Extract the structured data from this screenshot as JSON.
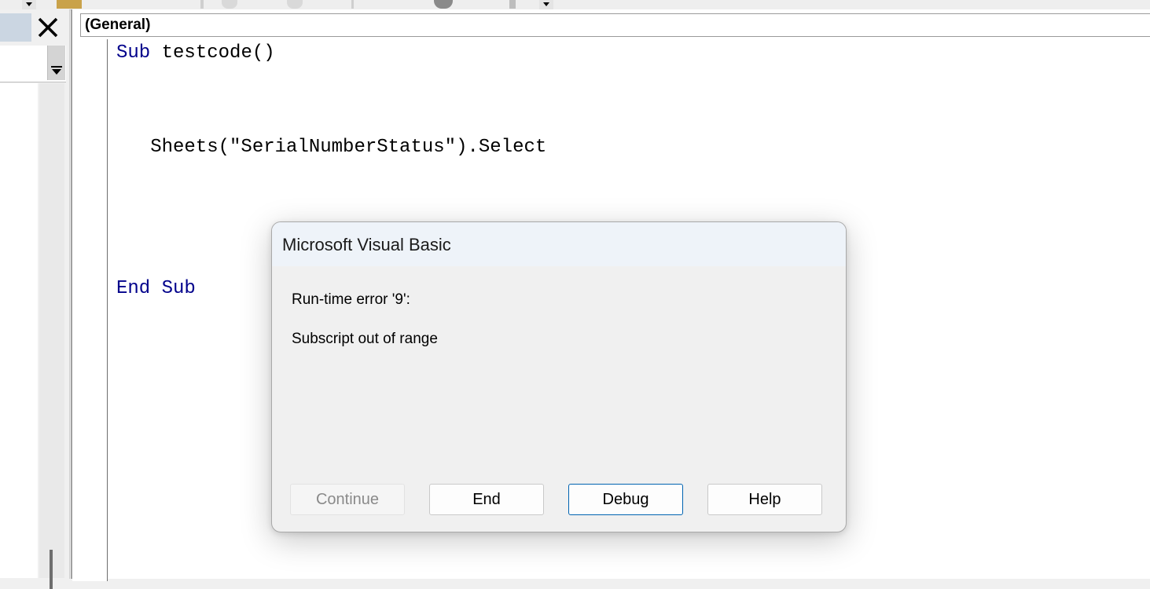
{
  "toolbar": {
    "icons": [
      "tool-icon",
      "undo-icon",
      "redo-icon",
      "object-browser-icon",
      "dropdown-arrow-icon"
    ]
  },
  "left_pane": {
    "close_icon": "close-icon",
    "combo_arrow_icon": "chevron-down-icon"
  },
  "code_window": {
    "procedure_combo": "(General)",
    "lines": [
      {
        "keyword": "Sub",
        "text": " testcode()"
      },
      {
        "keyword": "",
        "text": "   Sheets(\"SerialNumberStatus\").Select"
      },
      {
        "keyword": "End Sub",
        "text": ""
      }
    ]
  },
  "dialog": {
    "title": "Microsoft Visual Basic",
    "message_line1": "Run-time error '9':",
    "message_line2": "Subscript out of range",
    "buttons": {
      "continue": "Continue",
      "end": "End",
      "debug": "Debug",
      "help": "Help"
    }
  },
  "colors": {
    "keyword": "#00008b",
    "default_button_border": "#0063b1",
    "titlebar": "#eef3f9"
  }
}
